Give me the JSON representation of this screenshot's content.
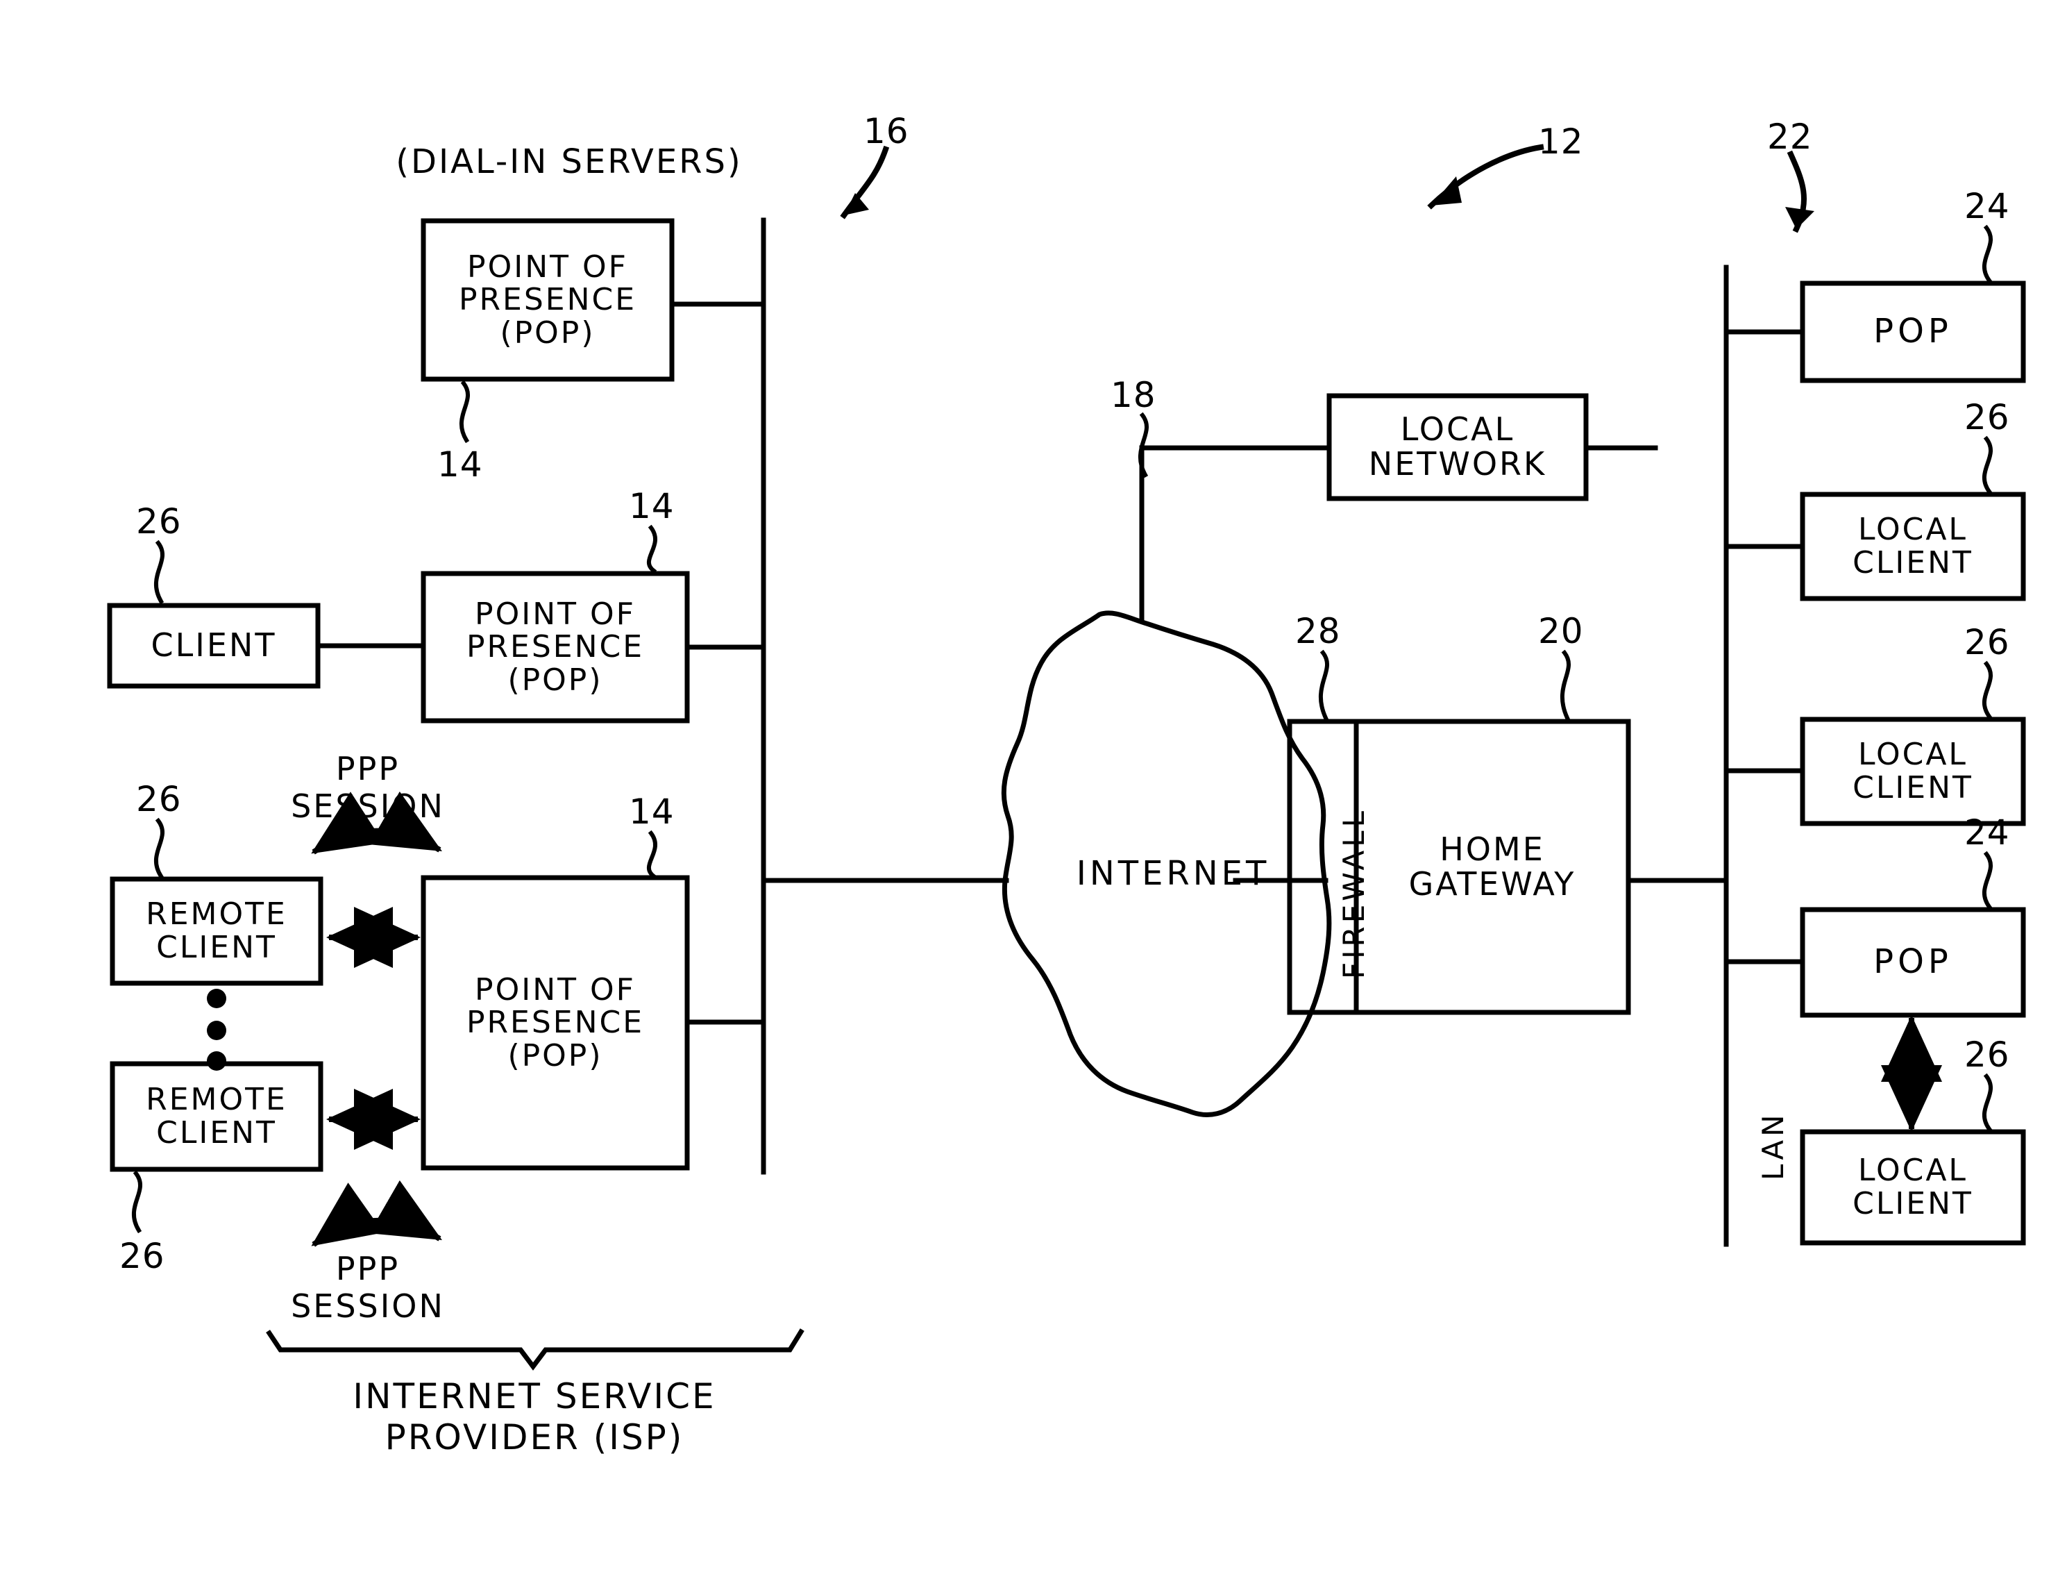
{
  "figure": {
    "type": "patent-network-diagram",
    "background_color": "#ffffff",
    "line_color": "#000000"
  },
  "group_labels": {
    "dial_in_servers": "(DIAL-IN SERVERS)",
    "isp": "INTERNET SERVICE\nPROVIDER (ISP)"
  },
  "reference_numerals": {
    "system": "12",
    "pop_left_top": "14",
    "pop_left_mid": "14",
    "pop_left_bottom": "14",
    "isp_bus": "16",
    "internet": "18",
    "home_gateway": "20",
    "lan": "22",
    "pop_right_top": "24",
    "pop_right_bottom": "24",
    "client_left": "26",
    "remote_client_top": "26",
    "remote_client_bottom": "26",
    "local_client_1": "26",
    "local_client_2": "26",
    "local_client_3": "26",
    "firewall": "28"
  },
  "nodes": {
    "pop_left_top": "POINT OF\nPRESENCE\n(POP)",
    "pop_left_mid": "POINT OF\nPRESENCE\n(POP)",
    "pop_left_bottom": "POINT OF\nPRESENCE\n(POP)",
    "client": "CLIENT",
    "remote_client_top": "REMOTE\nCLIENT",
    "remote_client_bottom": "REMOTE\nCLIENT",
    "internet": "INTERNET",
    "local_network": "LOCAL\nNETWORK",
    "firewall": "FIREWALL",
    "home_gateway": "HOME\nGATEWAY",
    "lan": "LAN",
    "pop_right_top": "POP",
    "pop_right_bottom": "POP",
    "local_client_1": "LOCAL\nCLIENT",
    "local_client_2": "LOCAL\nCLIENT",
    "local_client_3": "LOCAL\nCLIENT"
  },
  "connection_labels": {
    "ppp_session_top": "PPP\nSESSION",
    "ppp_session_bottom": "PPP\nSESSION"
  },
  "ellipsis": {
    "remote_clients": "•••"
  }
}
